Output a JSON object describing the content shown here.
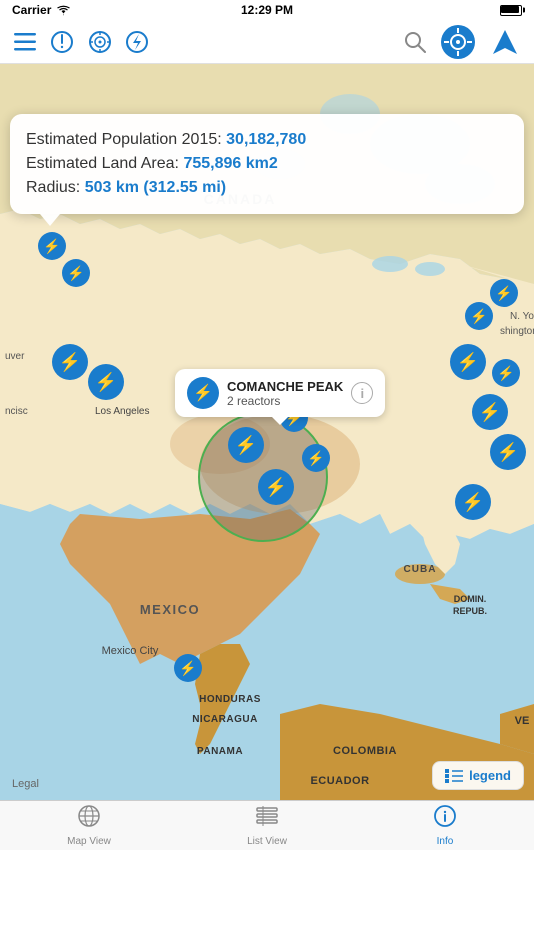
{
  "statusBar": {
    "carrier": "Carrier",
    "wifi": true,
    "time": "12:29 PM",
    "battery": "full"
  },
  "navBar": {
    "menuIcon": "☰",
    "alertIcon": "⚠",
    "targetIcon": "◎",
    "boltIcon": "⚡",
    "searchIcon": "🔍",
    "locationIcon": "📍",
    "navigateIcon": "➤"
  },
  "infoPopup": {
    "line1_label": "Estimated Population 2015: ",
    "line1_value": "30,182,780",
    "line2_label": "Estimated Land Area: ",
    "line2_value": "755,896 km2",
    "line3_label": "Radius: ",
    "line3_value": "503 km (312.55 mi)"
  },
  "plantCallout": {
    "name": "COMANCHE PEAK",
    "reactors": "2 reactors"
  },
  "mapLabels": {
    "canada": "CANADA",
    "mexico": "MEXICO",
    "mexicoCity": "Mexico City",
    "cuba": "CUBA",
    "honduras": "HONDURAS",
    "nicaragua": "NICARAGUA",
    "panama": "PANAMA",
    "colombia": "COLOMBIA",
    "ecuador": "ECUADOR",
    "dominicanRep": "DOMIN.\nREPUB.",
    "venezuela": "VE",
    "losAngeles": "Los Angeles",
    "uver": "uver",
    "ncisc": "ncisc",
    "nYork": "N. Yo",
    "shington": "shington"
  },
  "legal": "Legal",
  "legend": {
    "icon": "≡",
    "label": "legend"
  },
  "tabs": [
    {
      "id": "map",
      "label": "Map View",
      "icon": "globe",
      "active": false
    },
    {
      "id": "list",
      "label": "List View",
      "icon": "list",
      "active": false
    },
    {
      "id": "info",
      "label": "Info",
      "icon": "info",
      "active": true
    }
  ]
}
